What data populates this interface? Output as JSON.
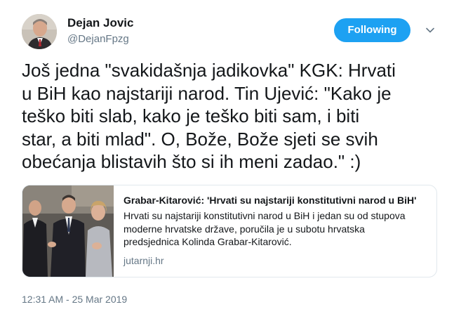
{
  "author": {
    "name": "Dejan Jovic",
    "handle": "@DejanFpzg"
  },
  "follow_button": {
    "label": "Following",
    "color": "#1da1f2"
  },
  "menu": {
    "icon": "chevron-down-icon"
  },
  "tweet": {
    "lines": [
      "Još jedna \"svakidašnja jadikovka\" KGK: Hrvati",
      "u BiH kao najstariji narod. Tin Ujević: \"Kako je",
      "teško biti slab, kako je teško biti sam, i biti",
      "star, a biti mlad\". O, Bože, Bože sjeti se svih",
      "obećanja blistavih što si ih meni zadao.\" :)"
    ]
  },
  "card": {
    "title": "Grabar-Kitarović: 'Hrvati su najstariji konstitutivni narod u BiH'",
    "description_lines": [
      "Hrvati su najstariji konstitutivni narod u BiH i jedan su od stupova",
      "moderne hrvatske države, poručila je u subotu hrvatska",
      "predsjednica Kolinda Grabar-Kitarović."
    ],
    "domain": "jutarnji.hr"
  },
  "timestamp": "12:31 AM - 25 Mar 2019",
  "colors": {
    "text": "#14171a",
    "secondary": "#657786",
    "border": "#e1e8ed"
  }
}
